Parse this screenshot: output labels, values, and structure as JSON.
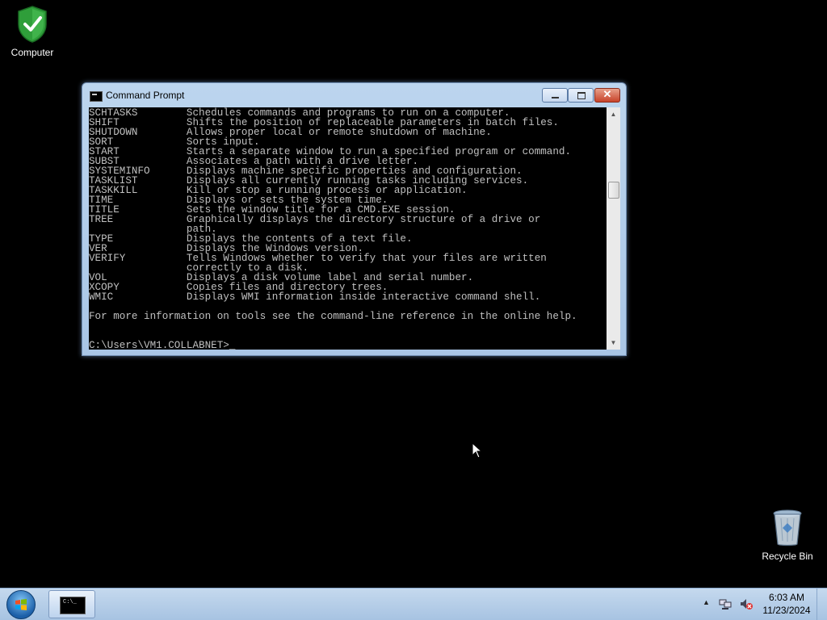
{
  "desktop": {
    "icons": [
      {
        "label": "Computer",
        "icon": "shield-check-icon"
      },
      {
        "label": "Recycle Bin",
        "icon": "recycle-bin-icon"
      }
    ]
  },
  "window": {
    "title": "Command Prompt",
    "console_lines": [
      "SCHTASKS        Schedules commands and programs to run on a computer.",
      "SHIFT           Shifts the position of replaceable parameters in batch files.",
      "SHUTDOWN        Allows proper local or remote shutdown of machine.",
      "SORT            Sorts input.",
      "START           Starts a separate window to run a specified program or command.",
      "SUBST           Associates a path with a drive letter.",
      "SYSTEMINFO      Displays machine specific properties and configuration.",
      "TASKLIST        Displays all currently running tasks including services.",
      "TASKKILL        Kill or stop a running process or application.",
      "TIME            Displays or sets the system time.",
      "TITLE           Sets the window title for a CMD.EXE session.",
      "TREE            Graphically displays the directory structure of a drive or",
      "                path.",
      "TYPE            Displays the contents of a text file.",
      "VER             Displays the Windows version.",
      "VERIFY          Tells Windows whether to verify that your files are written",
      "                correctly to a disk.",
      "VOL             Displays a disk volume label and serial number.",
      "XCOPY           Copies files and directory trees.",
      "WMIC            Displays WMI information inside interactive command shell.",
      "",
      "For more information on tools see the command-line reference in the online help.",
      "",
      "",
      "C:\\Users\\VM1.COLLABNET>_"
    ]
  },
  "taskbar": {
    "clock_time": "6:03 AM",
    "clock_date": "11/23/2024",
    "task_icon_text": "C:\\_"
  }
}
